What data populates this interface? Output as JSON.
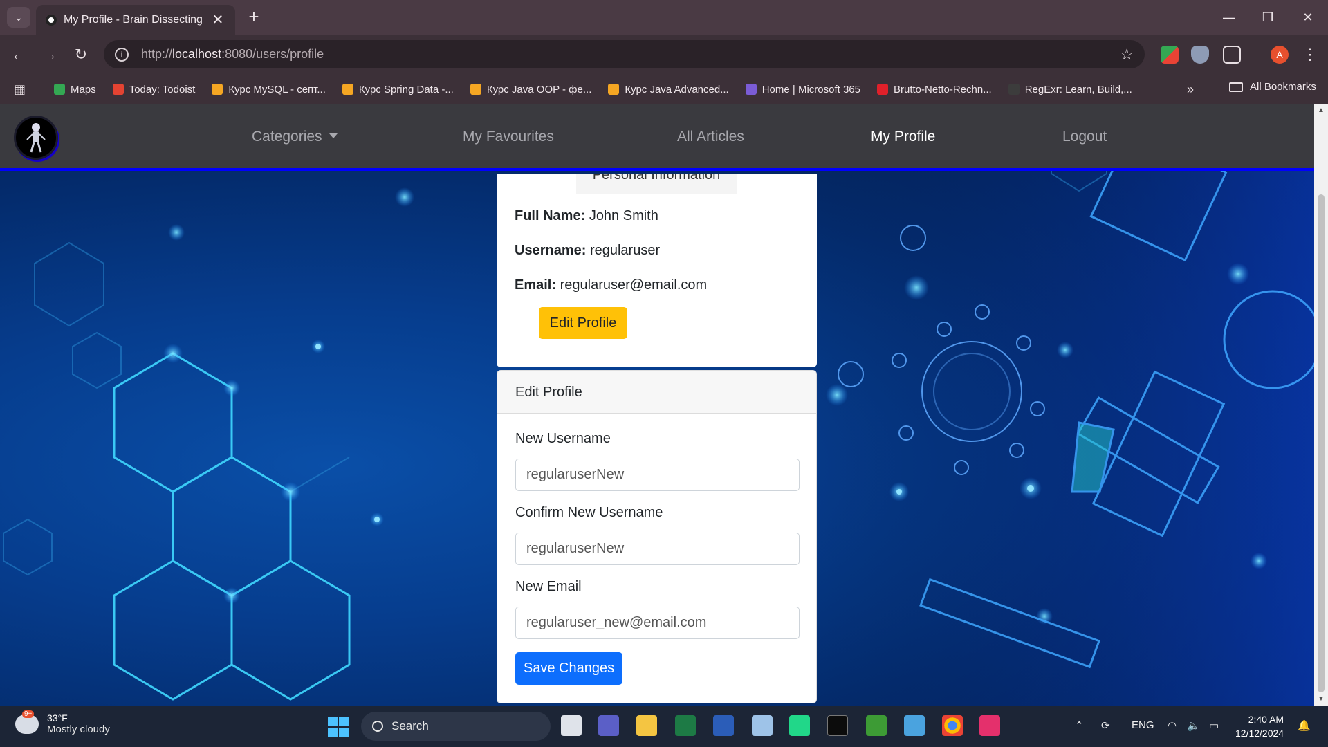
{
  "browser": {
    "tab_title": "My Profile - Brain Dissecting",
    "url_prefix": "http://",
    "url_host": "localhost",
    "url_rest": ":8080/users/profile",
    "bookmarks": [
      {
        "label": "Maps",
        "color": "#34a853"
      },
      {
        "label": "Today: Todoist",
        "color": "#e44332"
      },
      {
        "label": "Курс MySQL - септ...",
        "color": "#f5a623"
      },
      {
        "label": "Курс Spring Data -...",
        "color": "#f5a623"
      },
      {
        "label": "Курс Java OOP - фе...",
        "color": "#f5a623"
      },
      {
        "label": "Курс Java Advanced...",
        "color": "#f5a623"
      },
      {
        "label": "Home | Microsoft 365",
        "color": "#7b5cd6"
      },
      {
        "label": "Brutto-Netto-Rechn...",
        "color": "#e0202a"
      },
      {
        "label": "RegExr: Learn, Build,...",
        "color": "#3c3c3c"
      }
    ],
    "all_bookmarks": "All Bookmarks",
    "profile_initial": "A"
  },
  "nav": {
    "categories": "Categories",
    "favourites": "My Favourites",
    "articles": "All Articles",
    "profile": "My Profile",
    "logout": "Logout"
  },
  "profile": {
    "section_tab": "Personal Information",
    "full_name_label": "Full Name:",
    "full_name": "John Smith",
    "username_label": "Username:",
    "username": "regularuser",
    "email_label": "Email:",
    "email": "regularuser@email.com",
    "edit_button": "Edit Profile"
  },
  "edit_form": {
    "header": "Edit Profile",
    "new_username_label": "New Username",
    "new_username_value": "regularuserNew",
    "confirm_username_label": "Confirm New Username",
    "confirm_username_value": "regularuserNew",
    "new_email_label": "New Email",
    "new_email_value": "regularuser_new@email.com",
    "save_button": "Save Changes"
  },
  "taskbar": {
    "weather_badge": "9+",
    "weather_temp": "33°F",
    "weather_desc": "Mostly cloudy",
    "search": "Search",
    "lang": "ENG",
    "time": "2:40 AM",
    "date": "12/12/2024"
  },
  "colors": {
    "accent_blue": "#0d6efd",
    "warning_yellow": "#ffc107",
    "navbar_border": "#0000ff"
  }
}
